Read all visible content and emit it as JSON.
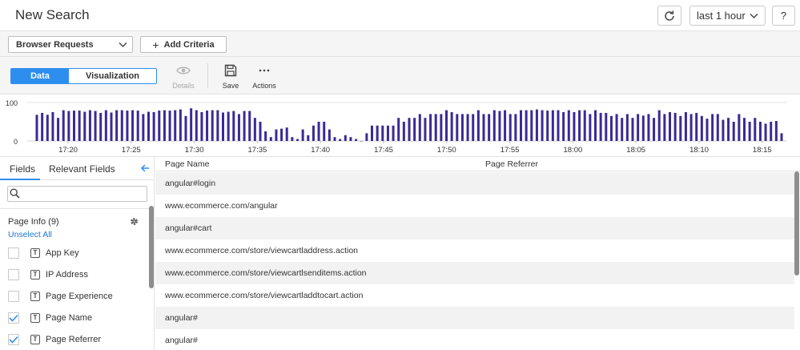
{
  "header": {
    "title": "New Search",
    "time_range": "last 1 hour",
    "help_label": "?"
  },
  "criteria": {
    "data_source": "Browser Requests",
    "add_label": "Add Criteria"
  },
  "toolbar": {
    "view_tabs": [
      "Data",
      "Visualization"
    ],
    "active_view": "Data",
    "details_label": "Details",
    "save_label": "Save",
    "actions_label": "Actions"
  },
  "colors": {
    "accent": "#2e8ef0",
    "bar": "#3b2a95",
    "link": "#2176d2"
  },
  "chart_data": {
    "type": "bar",
    "y_ticks": [
      "100",
      "0"
    ],
    "ylim": [
      0,
      100
    ],
    "x_tick_labels": [
      "17:20",
      "17:25",
      "17:30",
      "17:35",
      "17:40",
      "17:45",
      "17:50",
      "17:55",
      "18:00",
      "18:05",
      "18:10",
      "18:15"
    ],
    "values": [
      68,
      73,
      68,
      75,
      60,
      80,
      78,
      79,
      79,
      76,
      80,
      78,
      73,
      80,
      74,
      80,
      80,
      79,
      80,
      79,
      70,
      76,
      75,
      79,
      80,
      79,
      80,
      82,
      65,
      85,
      80,
      75,
      79,
      80,
      80,
      74,
      76,
      78,
      70,
      78,
      78,
      60,
      50,
      25,
      10,
      30,
      32,
      35,
      10,
      5,
      30,
      15,
      40,
      50,
      50,
      30,
      10,
      5,
      15,
      10,
      5,
      0,
      20,
      40,
      40,
      40,
      40,
      40,
      60,
      50,
      60,
      60,
      70,
      60,
      70,
      70,
      70,
      80,
      75,
      70,
      70,
      70,
      70,
      80,
      70,
      70,
      80,
      78,
      80,
      70,
      70,
      80,
      80,
      80,
      82,
      80,
      79,
      80,
      80,
      75,
      80,
      75,
      80,
      80,
      70,
      80,
      73,
      73,
      65,
      70,
      60,
      70,
      60,
      70,
      66,
      70,
      60,
      80,
      70,
      75,
      73,
      65,
      75,
      70,
      73,
      65,
      58,
      70,
      70,
      55,
      60,
      50,
      70,
      60,
      50,
      60,
      50,
      45,
      50,
      52,
      20
    ]
  },
  "sidebar": {
    "tabs": [
      "Fields",
      "Relevant Fields"
    ],
    "active_tab": "Fields",
    "search_placeholder": "",
    "group_title": "Page Info (9)",
    "unselect_label": "Unselect All",
    "type_chip": "T",
    "fields": [
      {
        "name": "App Key",
        "checked": false
      },
      {
        "name": "IP Address",
        "checked": false
      },
      {
        "name": "Page Experience",
        "checked": false
      },
      {
        "name": "Page Name",
        "checked": true
      },
      {
        "name": "Page Referrer",
        "checked": true
      }
    ]
  },
  "table": {
    "columns": [
      "Page Name",
      "Page Referrer"
    ],
    "rows": [
      [
        "angular#login",
        ""
      ],
      [
        "www.ecommerce.com/angular",
        ""
      ],
      [
        "angular#cart",
        ""
      ],
      [
        "www.ecommerce.com/store/viewcartladdress.action",
        ""
      ],
      [
        "www.ecommerce.com/store/viewcartlsenditems.action",
        ""
      ],
      [
        "www.ecommerce.com/store/viewcartladdtocart.action",
        ""
      ],
      [
        "angular#",
        ""
      ],
      [
        "angular#",
        ""
      ]
    ]
  }
}
